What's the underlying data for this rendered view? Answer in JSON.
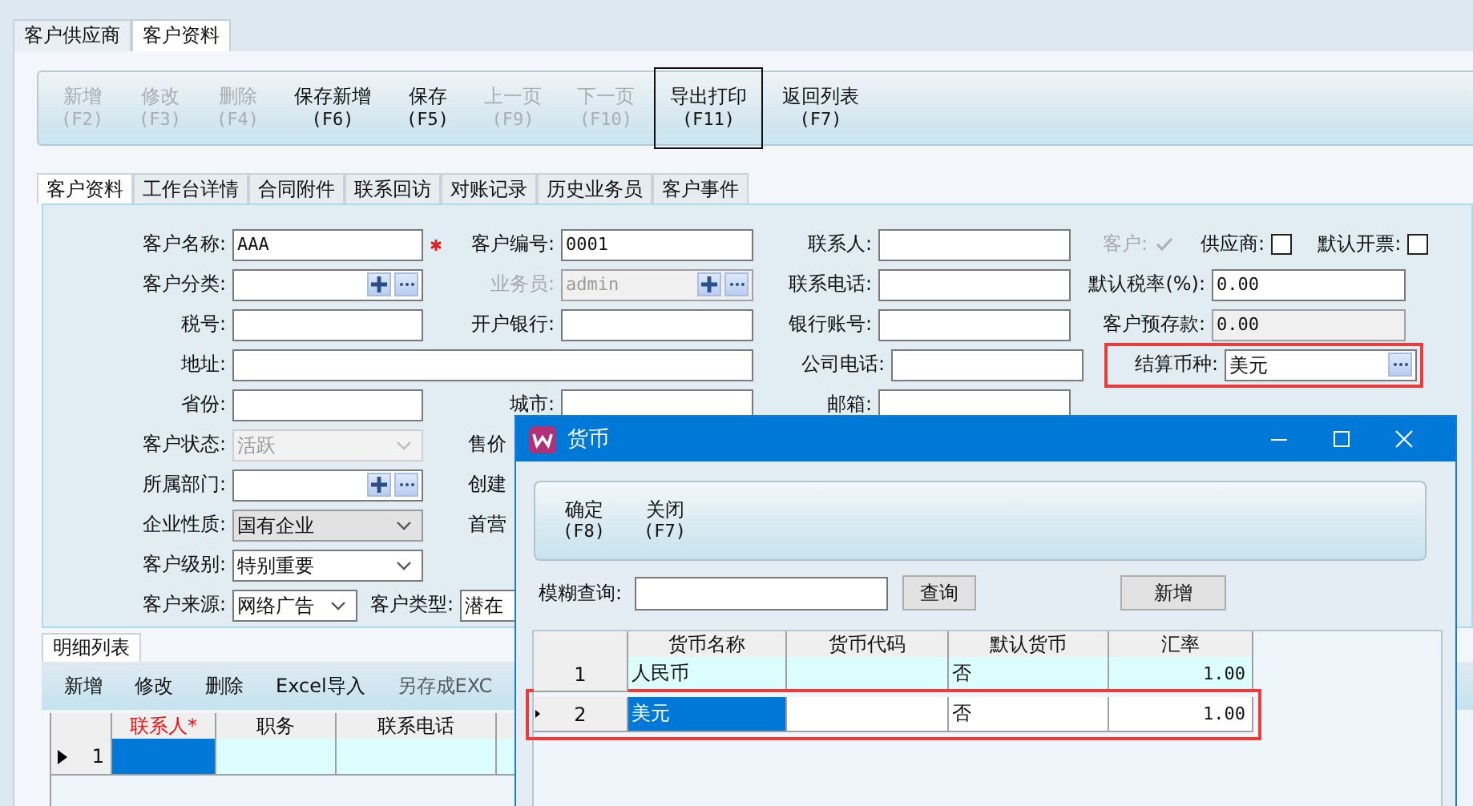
{
  "outer_tabs": [
    {
      "label": "客户供应商",
      "selected": false
    },
    {
      "label": "客户资料",
      "selected": true
    }
  ],
  "toolbar": [
    {
      "label": "新增",
      "key": "(F2)",
      "disabled": true,
      "focused": false
    },
    {
      "label": "修改",
      "key": "(F3)",
      "disabled": true,
      "focused": false
    },
    {
      "label": "删除",
      "key": "(F4)",
      "disabled": true,
      "focused": false
    },
    {
      "label": "保存新增",
      "key": "(F6)",
      "disabled": false,
      "focused": false
    },
    {
      "label": "保存",
      "key": "(F5)",
      "disabled": false,
      "focused": false
    },
    {
      "label": "上一页",
      "key": "(F9)",
      "disabled": true,
      "focused": false
    },
    {
      "label": "下一页",
      "key": "(F10)",
      "disabled": true,
      "focused": false
    },
    {
      "label": "导出打印",
      "key": "(F11)",
      "disabled": false,
      "focused": true
    },
    {
      "label": "返回列表",
      "key": "(F7)",
      "disabled": false,
      "focused": false
    }
  ],
  "form_tabs": [
    {
      "label": "客户资料",
      "selected": true
    },
    {
      "label": "工作台详情",
      "selected": false
    },
    {
      "label": "合同附件",
      "selected": false
    },
    {
      "label": "联系回访",
      "selected": false
    },
    {
      "label": "对账记录",
      "selected": false
    },
    {
      "label": "历史业务员",
      "selected": false
    },
    {
      "label": "客户事件",
      "selected": false
    }
  ],
  "form_rows": [
    [
      {
        "label": "客户名称:",
        "kind": "text",
        "value": "AAA",
        "required": true
      },
      {
        "label": "客户编号:",
        "kind": "text",
        "value": "0001"
      },
      {
        "label": "联系人:",
        "kind": "text"
      },
      {
        "kind": "checks",
        "items": [
          {
            "label": "客户:",
            "checked": true,
            "disabled": true
          },
          {
            "label": "供应商:",
            "checked": false,
            "disabled": false
          },
          {
            "label": "默认开票:",
            "checked": false,
            "disabled": false
          }
        ]
      }
    ],
    [
      {
        "label": "客户分类:",
        "kind": "picker"
      },
      {
        "label": "业务员:",
        "kind": "picker_locked",
        "value": "admin"
      },
      {
        "label": "联系电话:",
        "kind": "text"
      },
      {
        "label": "默认税率(%):",
        "kind": "text",
        "value": "0.00"
      }
    ],
    [
      {
        "label": "税号:",
        "kind": "text"
      },
      {
        "label": "开户银行:",
        "kind": "text"
      },
      {
        "label": "银行账号:",
        "kind": "text"
      },
      {
        "label": "客户预存款:",
        "kind": "text_locked",
        "value": "0.00"
      }
    ],
    [
      {
        "label": "地址:",
        "kind": "wide"
      },
      {
        "label": "公司电话:",
        "kind": "text"
      },
      {
        "label": "结算币种:",
        "kind": "lookup",
        "value": "美元",
        "highlighted": true
      }
    ],
    [
      {
        "label": "省份:",
        "kind": "text"
      },
      {
        "label": "城市:",
        "kind": "text"
      },
      {
        "label": "邮箱:",
        "kind": "text"
      }
    ],
    [
      {
        "label": "客户状态:",
        "kind": "combo_locked",
        "value": "活跃"
      },
      {
        "label": "售价",
        "kind": "cut"
      }
    ],
    [
      {
        "label": "所属部门:",
        "kind": "picker"
      },
      {
        "label": "创建",
        "kind": "cut"
      }
    ],
    [
      {
        "label": "企业性质:",
        "kind": "dropdown",
        "value": "国有企业"
      },
      {
        "label": "首营",
        "kind": "cut"
      }
    ],
    [
      {
        "label": "客户级别:",
        "kind": "combo",
        "value": "特别重要"
      }
    ]
  ],
  "source_row": {
    "label": "客户来源:",
    "value": "网络广告",
    "type_label": "客户类型:",
    "type_value": "潜在"
  },
  "detail": {
    "tab": "明细列表",
    "toolbar": [
      {
        "label": "新增",
        "disabled": false
      },
      {
        "label": "修改",
        "disabled": false
      },
      {
        "label": "删除",
        "disabled": false
      },
      {
        "label": "Excel导入",
        "disabled": false
      },
      {
        "label": "另存成EXC",
        "disabled": true
      }
    ],
    "columns": [
      {
        "label": "联系人*",
        "required": true
      },
      {
        "label": "职务",
        "required": false
      },
      {
        "label": "联系电话",
        "required": false
      }
    ],
    "rows": [
      {
        "number": "1",
        "selected": true
      }
    ]
  },
  "dialog": {
    "title": "货币",
    "toolbar": [
      {
        "label": "确定",
        "key": "(F8)"
      },
      {
        "label": "关闭",
        "key": "(F7)"
      }
    ],
    "search_label": "模糊查询:",
    "search_button": "查询",
    "add_button": "新增",
    "columns": [
      "货币名称",
      "货币代码",
      "默认货币",
      "汇率"
    ],
    "rows": [
      {
        "number": "1",
        "name": "人民币",
        "default": "否",
        "rate": "1.00",
        "selected": false,
        "highlighted": false
      },
      {
        "number": "2",
        "name": "美元",
        "default": "否",
        "rate": "1.00",
        "selected": true,
        "highlighted": true
      }
    ]
  }
}
